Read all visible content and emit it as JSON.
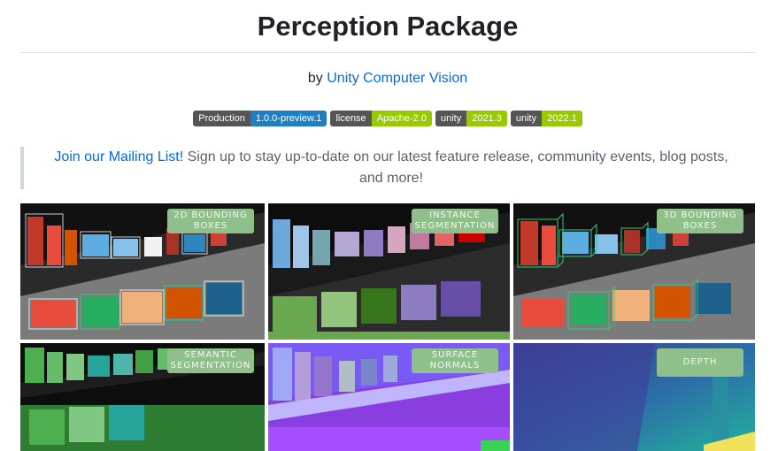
{
  "page": {
    "title": "Perception Package",
    "byline_prefix": "by",
    "byline_link": "Unity Computer Vision"
  },
  "badges": [
    {
      "label": "Production",
      "value": "1.0.0-preview.1",
      "color": "#1f7fc1"
    },
    {
      "label": "license",
      "value": "Apache-2.0",
      "color": "#97ca00"
    },
    {
      "label": "unity",
      "value": "2021.3",
      "color": "#97ca00"
    },
    {
      "label": "unity",
      "value": "2022.1",
      "color": "#97ca00"
    }
  ],
  "mailing": {
    "link_text": "Join our Mailing List!",
    "text": " Sign up to stay up-to-date on our latest feature release, community events, blog posts, and more!"
  },
  "gallery": [
    {
      "label_line1": "2D BOUNDING",
      "label_line2": "BOXES",
      "icon": "shelf-bbox-2d-image"
    },
    {
      "label_line1": "INSTANCE",
      "label_line2": "SEGMENTATION",
      "icon": "shelf-instance-seg-image"
    },
    {
      "label_line1": "3D BOUNDING",
      "label_line2": "BOXES",
      "icon": "shelf-bbox-3d-image"
    },
    {
      "label_line1": "SEMANTIC",
      "label_line2": "SEGMENTATION",
      "icon": "shelf-semantic-seg-image"
    },
    {
      "label_line1": "SURFACE",
      "label_line2": "NORMALS",
      "icon": "shelf-normals-image"
    },
    {
      "label_line1": "DEPTH",
      "label_line2": "",
      "icon": "shelf-depth-image"
    }
  ],
  "colors": {
    "link": "#0969da",
    "badge_left": "#555555",
    "tag_bg": "#8fbf8a"
  }
}
